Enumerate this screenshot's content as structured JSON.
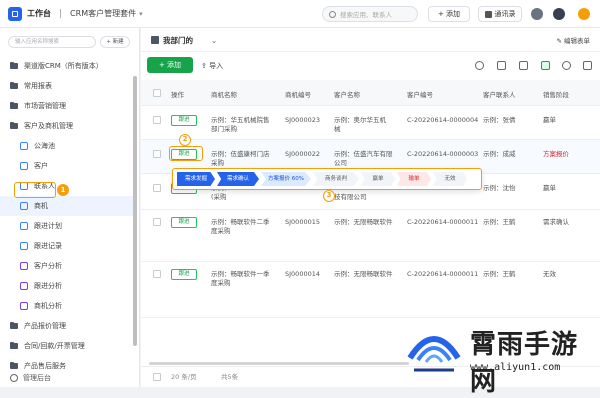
{
  "header": {
    "app_name": "工作台",
    "breadcrumb": "CRM客户管理套件",
    "search_placeholder": "搜索应用、联系人",
    "add_label": "+ 添加",
    "contacts_label": "通讯录"
  },
  "sidebar": {
    "search_placeholder": "输入应用名称搜索",
    "new_label": "+ 新建",
    "items": [
      {
        "label": "渠道版CRM（所有版本）",
        "type": "folder"
      },
      {
        "label": "常用报表",
        "type": "folder"
      },
      {
        "label": "市场营销管理",
        "type": "folder"
      },
      {
        "label": "客户及商机管理",
        "type": "folder"
      },
      {
        "label": "公海池",
        "type": "sub"
      },
      {
        "label": "客户",
        "type": "sub"
      },
      {
        "label": "联系人",
        "type": "sub"
      },
      {
        "label": "商机",
        "type": "sub",
        "active": true
      },
      {
        "label": "跟进计划",
        "type": "sub"
      },
      {
        "label": "跟进记录",
        "type": "sub"
      },
      {
        "label": "客户分析",
        "type": "sub-purple"
      },
      {
        "label": "跟进分析",
        "type": "sub-purple"
      },
      {
        "label": "商机分析",
        "type": "sub-purple"
      },
      {
        "label": "产品报价管理",
        "type": "folder"
      },
      {
        "label": "合同/回款/开票管理",
        "type": "folder"
      },
      {
        "label": "产品售后服务",
        "type": "folder"
      }
    ],
    "bottom_label": "管理后台"
  },
  "main": {
    "view_name": "我部门的",
    "edit_view_label": "编辑表单",
    "add_button": "+ 添加",
    "import_button": "导入",
    "columns": [
      "操作",
      "商机名称",
      "商机编号",
      "客户名称",
      "客户编号",
      "客户联系人",
      "销售阶段"
    ],
    "follow_label": "跟进",
    "rows": [
      {
        "name": [
          "示例：华五机械院售",
          "部门采购"
        ],
        "code": "SJ0000023",
        "customer": [
          "示例：奥尔华五机",
          "械"
        ],
        "customer_code": "C-20220614-0000004",
        "contact": "示例：张倩",
        "stage": "赢单"
      },
      {
        "name": [
          "示例：伍盛康柯门店",
          "采购"
        ],
        "code": "SJ0000022",
        "customer": [
          "示例：伍盛汽车有限",
          "公司"
        ],
        "customer_code": "C-20220614-0000003",
        "contact": "示例：成威",
        "stage": "方案报价",
        "highlight": true
      },
      {
        "name": [
          "示例：",
          "(采购"
        ],
        "code": "",
        "customer": [
          "",
          "技有限公司"
        ],
        "customer_code": "",
        "contact": "示例：沈怡",
        "stage": "赢单"
      },
      {
        "name": [
          "示例：畅联软件二季",
          "度采购"
        ],
        "code": "SJ0000015",
        "customer": [
          "示例：无限畅联软件",
          ""
        ],
        "customer_code": "C-20220614-0000011",
        "contact": "示例：王鹤",
        "stage": "需求确认"
      },
      {
        "name": [
          "示例：畅联软件一季",
          "度采购"
        ],
        "code": "SJ0000014",
        "customer": [
          "示例：无限畅联软件",
          ""
        ],
        "customer_code": "C-20220614-0000011",
        "contact": "示例：王鹤",
        "stage": "无效"
      }
    ],
    "stages": [
      {
        "label": "需求发掘",
        "state": "done"
      },
      {
        "label": "需求确认",
        "state": "done"
      },
      {
        "label": "方案报价 60%",
        "state": "current"
      },
      {
        "label": "商务谈判",
        "state": "todo"
      },
      {
        "label": "赢单",
        "state": "todo"
      },
      {
        "label": "输单",
        "state": "lost"
      },
      {
        "label": "无效",
        "state": "todo"
      }
    ],
    "footer": {
      "page_size": "20 条/页",
      "total": "共5条"
    }
  },
  "annotations": [
    "1",
    "2",
    "3"
  ],
  "watermark": {
    "title": "霄雨手游网",
    "url": "www.aliyun1.com"
  },
  "colors": {
    "accent": "#2563eb",
    "primary_green": "#16a34a",
    "annotation": "#f59e0b",
    "stage_blue": "#3b82f6"
  }
}
